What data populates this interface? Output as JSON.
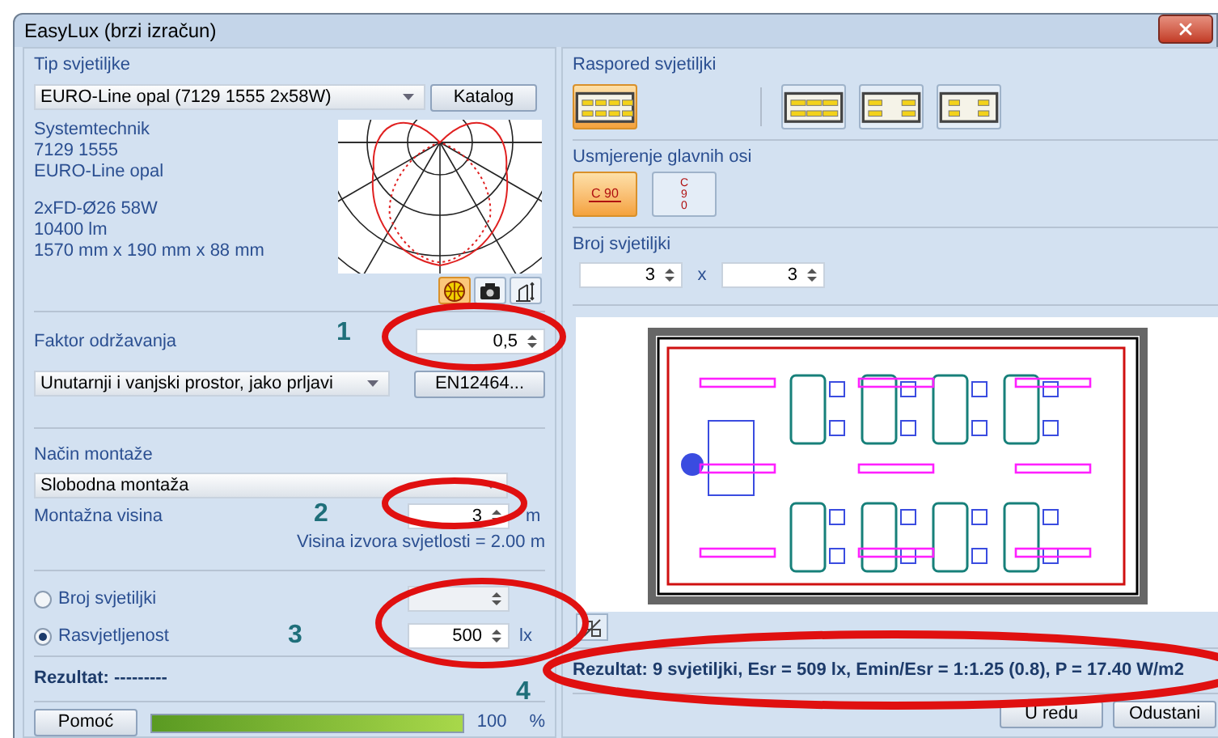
{
  "window": {
    "title": "EasyLux (brzi izračun)"
  },
  "luminaire": {
    "heading": "Tip svjetiljke",
    "select": "EURO-Line opal (7129 1555 2x58W)",
    "catalog_button": "Katalog",
    "info": [
      [
        "Systemtechnik",
        "7129 1555",
        "EURO-Line opal"
      ],
      [
        "2xFD-Ø26 58W",
        "10400 lm",
        "1570 mm x 190 mm x 88 mm"
      ]
    ]
  },
  "diagram_views": [
    {
      "kind": "polar",
      "selected": true
    },
    {
      "kind": "photo",
      "selected": false
    },
    {
      "kind": "chart",
      "selected": false
    }
  ],
  "maintenance": {
    "label": "Faktor održavanja",
    "value": "0,5",
    "environment": "Unutarnji i vanjski prostor, jako prljavi",
    "standard_button": "EN12464..."
  },
  "mounting": {
    "heading": "Način montaže",
    "select": "Slobodna montaža",
    "height_label": "Montažna visina",
    "height_value": "3",
    "height_unit": "m",
    "note": "Visina izvora svjetlosti = 2.00 m"
  },
  "mode": [
    {
      "label": "Broj svjetiljki",
      "selected": false
    },
    {
      "label": "Rasvjetljenost",
      "selected": true,
      "value": "500",
      "unit": "lx"
    }
  ],
  "left_result": "Rezultat: ---------",
  "help_button": "Pomoć",
  "progress": {
    "level": 1,
    "reading": "100",
    "unit": "%"
  },
  "layout": {
    "heading": "Raspored svjetiljki",
    "options": [
      {
        "kind": "grid",
        "selected": true
      },
      {
        "kind": "rows",
        "selected": false
      },
      {
        "kind": "rows-spaced",
        "selected": false
      },
      {
        "kind": "grid-spaced",
        "selected": false
      }
    ]
  },
  "orientation": {
    "heading": "Usmjerenje glavnih osi",
    "options": [
      {
        "kind": "horizontal",
        "label": "C 90",
        "selected": true
      },
      {
        "kind": "vertical",
        "label": "C 90",
        "selected": false
      }
    ]
  },
  "count": {
    "heading": "Broj svjetiljki",
    "columns": "3",
    "separator": "x",
    "rows": "3"
  },
  "result": "Rezultat: 9 svjetiljki, Esr = 509 lx, Emin/Esr = 1:1.25 (0.8), P = 17.40 W/m2",
  "buttons": [
    "U redu",
    "Odustani"
  ],
  "annotations": [
    "1",
    "2",
    "3",
    "4"
  ]
}
